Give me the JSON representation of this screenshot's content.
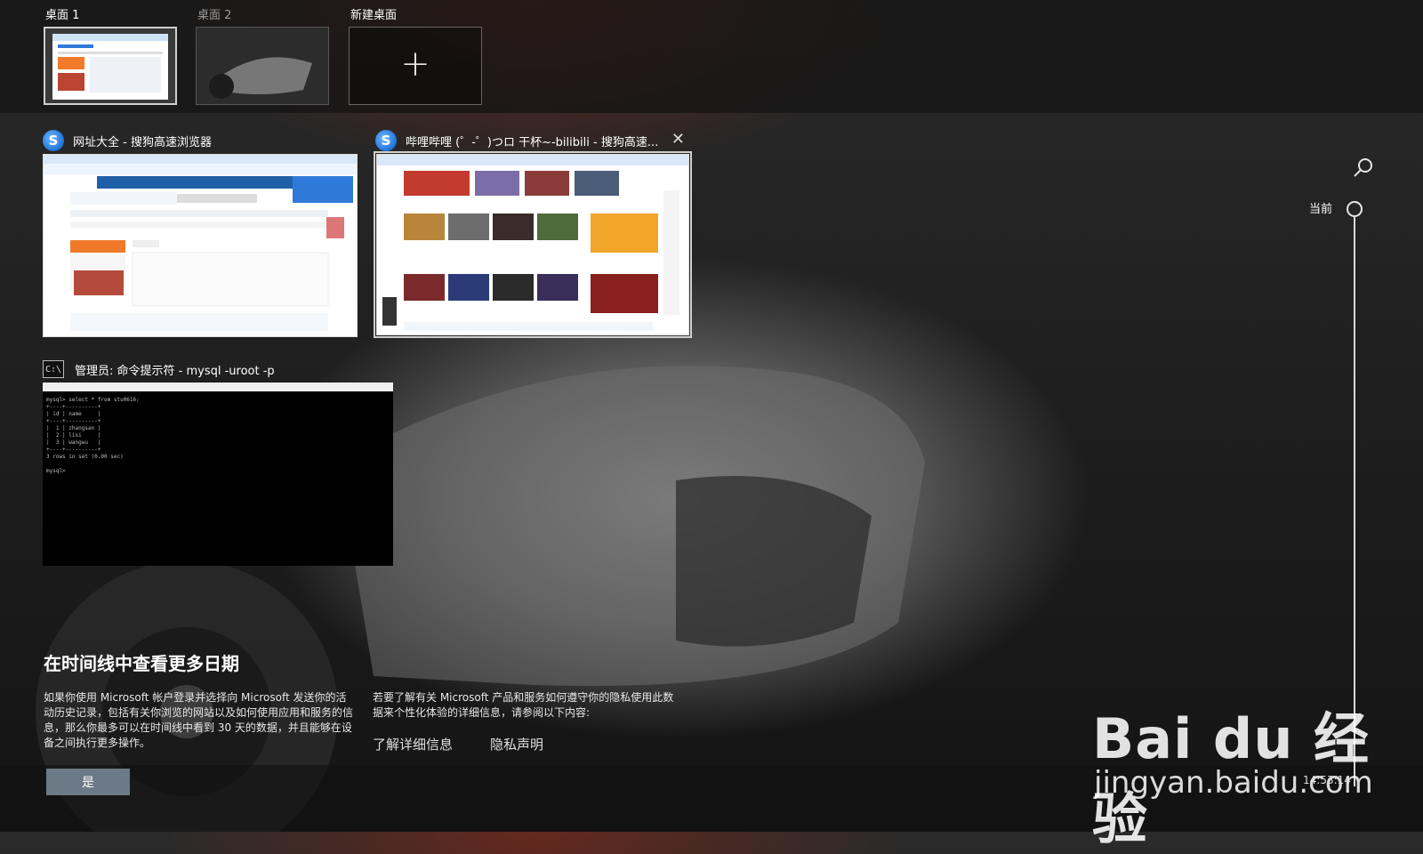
{
  "desktops": [
    {
      "label": "桌面 1",
      "active": true
    },
    {
      "label": "桌面 2",
      "active": false
    },
    {
      "label": "新建桌面"
    }
  ],
  "windows": [
    {
      "title": "网址大全 - 搜狗高速浏览器",
      "app": "sogou-browser"
    },
    {
      "title": "哔哩哔哩 (゜-゜)つロ 干杯~-bilibili - 搜狗高速...",
      "app": "sogou-browser"
    },
    {
      "title": "管理员: 命令提示符 - mysql  -uroot -p",
      "app": "cmd",
      "console": "mysql> select * from stu0616;\n+----+----------+\n| id | name     |\n+----+----------+\n|  1 | zhangsan |\n|  2 | lisi     |\n|  3 | wangwu   |\n+----+----------+\n3 rows in set (0.00 sec)\n\nmysql>"
    }
  ],
  "timeline": {
    "current_label": "当前"
  },
  "promo": {
    "title": "在时间线中查看更多日期",
    "left_text": "如果你使用 Microsoft 帐户登录并选择向 Microsoft 发送你的活动历史记录，包括有关你浏览的网站以及如何使用应用和服务的信息，那么你最多可以在时间线中看到 30 天的数据，并且能够在设备之间执行更多操作。",
    "right_text": "若要了解有关 Microsoft 产品和服务如何遵守你的隐私使用此数据来个性化体验的详细信息，请参阅以下内容:",
    "link_learn_more": "了解详细信息",
    "link_privacy": "隐私声明",
    "yes_button": "是"
  },
  "watermark": {
    "logo": "Bai du 经验",
    "url": "jingyan.baidu.com",
    "extra": "14:53:14"
  },
  "icons": {
    "search": "search-icon",
    "close": "close-icon",
    "plus": "plus-icon"
  }
}
